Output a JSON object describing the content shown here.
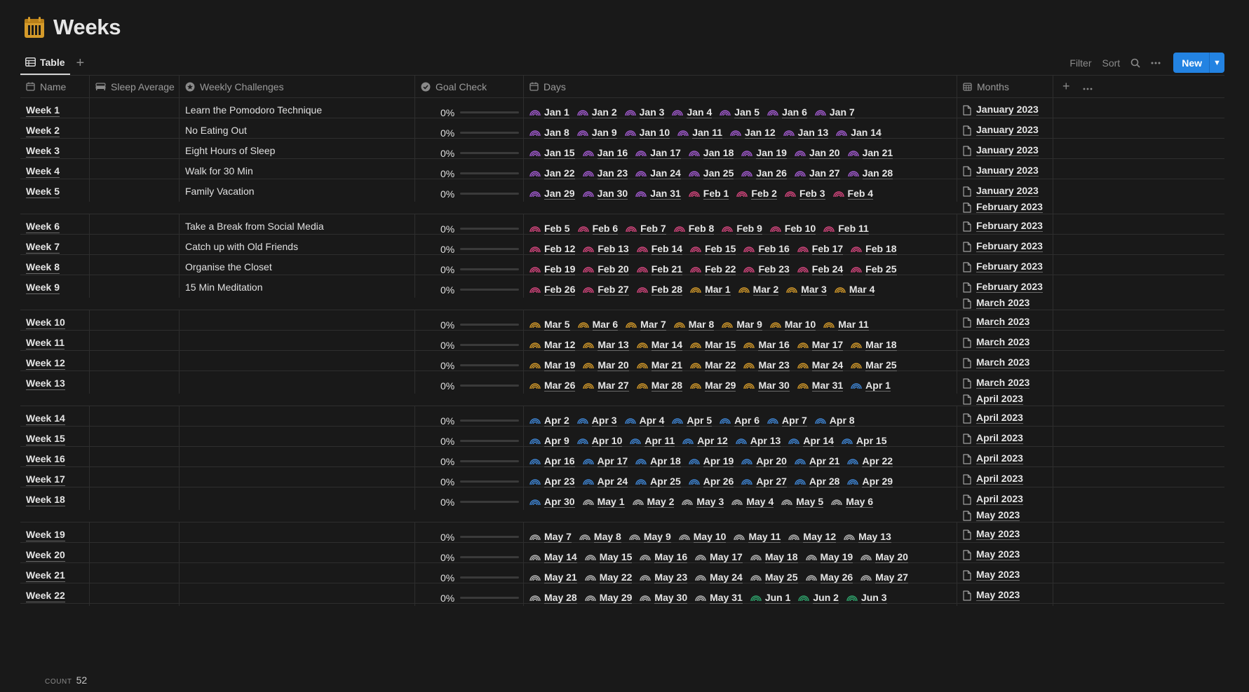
{
  "page": {
    "title": "Weeks"
  },
  "view": {
    "tab_label": "Table",
    "filter_label": "Filter",
    "sort_label": "Sort",
    "new_label": "New"
  },
  "columns": {
    "name": "Name",
    "sleep": "Sleep Average",
    "challenges": "Weekly Challenges",
    "goal": "Goal Check",
    "days": "Days",
    "months": "Months"
  },
  "colors": {
    "jan": "#a35bd1",
    "feb": "#d6467e",
    "mar": "#d49a2a",
    "apr": "#3f86d6",
    "may": "#b8b8b8",
    "jun": "#2fa56d",
    "accent": "#2383e2"
  },
  "rows": [
    {
      "name": "Week 1",
      "challenge": "Learn the Pomodoro Technique",
      "goal": "0%",
      "progress": 0,
      "days": [
        [
          "Jan 1",
          "jan"
        ],
        [
          "Jan 2",
          "jan"
        ],
        [
          "Jan 3",
          "jan"
        ],
        [
          "Jan 4",
          "jan"
        ],
        [
          "Jan 5",
          "jan"
        ],
        [
          "Jan 6",
          "jan"
        ],
        [
          "Jan 7",
          "jan"
        ]
      ],
      "months": [
        "January 2023"
      ]
    },
    {
      "name": "Week 2",
      "challenge": "No Eating Out",
      "goal": "0%",
      "progress": 0,
      "days": [
        [
          "Jan 8",
          "jan"
        ],
        [
          "Jan 9",
          "jan"
        ],
        [
          "Jan 10",
          "jan"
        ],
        [
          "Jan 11",
          "jan"
        ],
        [
          "Jan 12",
          "jan"
        ],
        [
          "Jan 13",
          "jan"
        ],
        [
          "Jan 14",
          "jan"
        ]
      ],
      "months": [
        "January 2023"
      ]
    },
    {
      "name": "Week 3",
      "challenge": "Eight Hours of Sleep",
      "goal": "0%",
      "progress": 0,
      "days": [
        [
          "Jan 15",
          "jan"
        ],
        [
          "Jan 16",
          "jan"
        ],
        [
          "Jan 17",
          "jan"
        ],
        [
          "Jan 18",
          "jan"
        ],
        [
          "Jan 19",
          "jan"
        ],
        [
          "Jan 20",
          "jan"
        ],
        [
          "Jan 21",
          "jan"
        ]
      ],
      "months": [
        "January 2023"
      ]
    },
    {
      "name": "Week 4",
      "challenge": "Walk for 30 Min",
      "goal": "0%",
      "progress": 0,
      "days": [
        [
          "Jan 22",
          "jan"
        ],
        [
          "Jan 23",
          "jan"
        ],
        [
          "Jan 24",
          "jan"
        ],
        [
          "Jan 25",
          "jan"
        ],
        [
          "Jan 26",
          "jan"
        ],
        [
          "Jan 27",
          "jan"
        ],
        [
          "Jan 28",
          "jan"
        ]
      ],
      "months": [
        "January 2023"
      ]
    },
    {
      "name": "Week 5",
      "challenge": "Family Vacation",
      "goal": "0%",
      "progress": 0,
      "days": [
        [
          "Jan 29",
          "jan"
        ],
        [
          "Jan 30",
          "jan"
        ],
        [
          "Jan 31",
          "jan"
        ],
        [
          "Feb 1",
          "feb"
        ],
        [
          "Feb 2",
          "feb"
        ],
        [
          "Feb 3",
          "feb"
        ],
        [
          "Feb 4",
          "feb"
        ]
      ],
      "months": [
        "January 2023",
        "February 2023"
      ]
    },
    {
      "name": "Week 6",
      "challenge": "Take a Break from Social Media",
      "goal": "0%",
      "progress": 0,
      "days": [
        [
          "Feb 5",
          "feb"
        ],
        [
          "Feb 6",
          "feb"
        ],
        [
          "Feb 7",
          "feb"
        ],
        [
          "Feb 8",
          "feb"
        ],
        [
          "Feb 9",
          "feb"
        ],
        [
          "Feb 10",
          "feb"
        ],
        [
          "Feb 11",
          "feb"
        ]
      ],
      "months": [
        "February 2023"
      ]
    },
    {
      "name": "Week 7",
      "challenge": "Catch up with Old Friends",
      "goal": "0%",
      "progress": 0,
      "days": [
        [
          "Feb 12",
          "feb"
        ],
        [
          "Feb 13",
          "feb"
        ],
        [
          "Feb 14",
          "feb"
        ],
        [
          "Feb 15",
          "feb"
        ],
        [
          "Feb 16",
          "feb"
        ],
        [
          "Feb 17",
          "feb"
        ],
        [
          "Feb 18",
          "feb"
        ]
      ],
      "months": [
        "February 2023"
      ]
    },
    {
      "name": "Week 8",
      "challenge": "Organise the Closet",
      "goal": "0%",
      "progress": 0,
      "days": [
        [
          "Feb 19",
          "feb"
        ],
        [
          "Feb 20",
          "feb"
        ],
        [
          "Feb 21",
          "feb"
        ],
        [
          "Feb 22",
          "feb"
        ],
        [
          "Feb 23",
          "feb"
        ],
        [
          "Feb 24",
          "feb"
        ],
        [
          "Feb 25",
          "feb"
        ]
      ],
      "months": [
        "February 2023"
      ]
    },
    {
      "name": "Week 9",
      "challenge": "15 Min Meditation",
      "goal": "0%",
      "progress": 0,
      "days": [
        [
          "Feb 26",
          "feb"
        ],
        [
          "Feb 27",
          "feb"
        ],
        [
          "Feb 28",
          "feb"
        ],
        [
          "Mar 1",
          "mar"
        ],
        [
          "Mar 2",
          "mar"
        ],
        [
          "Mar 3",
          "mar"
        ],
        [
          "Mar 4",
          "mar"
        ]
      ],
      "months": [
        "February 2023",
        "March 2023"
      ]
    },
    {
      "name": "Week 10",
      "challenge": "",
      "goal": "0%",
      "progress": 0,
      "days": [
        [
          "Mar 5",
          "mar"
        ],
        [
          "Mar 6",
          "mar"
        ],
        [
          "Mar 7",
          "mar"
        ],
        [
          "Mar 8",
          "mar"
        ],
        [
          "Mar 9",
          "mar"
        ],
        [
          "Mar 10",
          "mar"
        ],
        [
          "Mar 11",
          "mar"
        ]
      ],
      "months": [
        "March 2023"
      ]
    },
    {
      "name": "Week 11",
      "challenge": "",
      "goal": "0%",
      "progress": 0,
      "days": [
        [
          "Mar 12",
          "mar"
        ],
        [
          "Mar 13",
          "mar"
        ],
        [
          "Mar 14",
          "mar"
        ],
        [
          "Mar 15",
          "mar"
        ],
        [
          "Mar 16",
          "mar"
        ],
        [
          "Mar 17",
          "mar"
        ],
        [
          "Mar 18",
          "mar"
        ]
      ],
      "months": [
        "March 2023"
      ]
    },
    {
      "name": "Week 12",
      "challenge": "",
      "goal": "0%",
      "progress": 0,
      "days": [
        [
          "Mar 19",
          "mar"
        ],
        [
          "Mar 20",
          "mar"
        ],
        [
          "Mar 21",
          "mar"
        ],
        [
          "Mar 22",
          "mar"
        ],
        [
          "Mar 23",
          "mar"
        ],
        [
          "Mar 24",
          "mar"
        ],
        [
          "Mar 25",
          "mar"
        ]
      ],
      "months": [
        "March 2023"
      ]
    },
    {
      "name": "Week 13",
      "challenge": "",
      "goal": "0%",
      "progress": 0,
      "days": [
        [
          "Mar 26",
          "mar"
        ],
        [
          "Mar 27",
          "mar"
        ],
        [
          "Mar 28",
          "mar"
        ],
        [
          "Mar 29",
          "mar"
        ],
        [
          "Mar 30",
          "mar"
        ],
        [
          "Mar 31",
          "mar"
        ],
        [
          "Apr 1",
          "apr"
        ]
      ],
      "months": [
        "March 2023",
        "April 2023"
      ]
    },
    {
      "name": "Week 14",
      "challenge": "",
      "goal": "0%",
      "progress": 0,
      "days": [
        [
          "Apr 2",
          "apr"
        ],
        [
          "Apr 3",
          "apr"
        ],
        [
          "Apr 4",
          "apr"
        ],
        [
          "Apr 5",
          "apr"
        ],
        [
          "Apr 6",
          "apr"
        ],
        [
          "Apr 7",
          "apr"
        ],
        [
          "Apr 8",
          "apr"
        ]
      ],
      "months": [
        "April 2023"
      ]
    },
    {
      "name": "Week 15",
      "challenge": "",
      "goal": "0%",
      "progress": 0,
      "days": [
        [
          "Apr 9",
          "apr"
        ],
        [
          "Apr 10",
          "apr"
        ],
        [
          "Apr 11",
          "apr"
        ],
        [
          "Apr 12",
          "apr"
        ],
        [
          "Apr 13",
          "apr"
        ],
        [
          "Apr 14",
          "apr"
        ],
        [
          "Apr 15",
          "apr"
        ]
      ],
      "months": [
        "April 2023"
      ]
    },
    {
      "name": "Week 16",
      "challenge": "",
      "goal": "0%",
      "progress": 0,
      "days": [
        [
          "Apr 16",
          "apr"
        ],
        [
          "Apr 17",
          "apr"
        ],
        [
          "Apr 18",
          "apr"
        ],
        [
          "Apr 19",
          "apr"
        ],
        [
          "Apr 20",
          "apr"
        ],
        [
          "Apr 21",
          "apr"
        ],
        [
          "Apr 22",
          "apr"
        ]
      ],
      "months": [
        "April 2023"
      ]
    },
    {
      "name": "Week 17",
      "challenge": "",
      "goal": "0%",
      "progress": 0,
      "days": [
        [
          "Apr 23",
          "apr"
        ],
        [
          "Apr 24",
          "apr"
        ],
        [
          "Apr 25",
          "apr"
        ],
        [
          "Apr 26",
          "apr"
        ],
        [
          "Apr 27",
          "apr"
        ],
        [
          "Apr 28",
          "apr"
        ],
        [
          "Apr 29",
          "apr"
        ]
      ],
      "months": [
        "April 2023"
      ]
    },
    {
      "name": "Week 18",
      "challenge": "",
      "goal": "0%",
      "progress": 0,
      "days": [
        [
          "Apr 30",
          "apr"
        ],
        [
          "May 1",
          "may"
        ],
        [
          "May 2",
          "may"
        ],
        [
          "May 3",
          "may"
        ],
        [
          "May 4",
          "may"
        ],
        [
          "May 5",
          "may"
        ],
        [
          "May 6",
          "may"
        ]
      ],
      "months": [
        "April 2023",
        "May 2023"
      ]
    },
    {
      "name": "Week 19",
      "challenge": "",
      "goal": "0%",
      "progress": 0,
      "days": [
        [
          "May 7",
          "may"
        ],
        [
          "May 8",
          "may"
        ],
        [
          "May 9",
          "may"
        ],
        [
          "May 10",
          "may"
        ],
        [
          "May 11",
          "may"
        ],
        [
          "May 12",
          "may"
        ],
        [
          "May 13",
          "may"
        ]
      ],
      "months": [
        "May 2023"
      ]
    },
    {
      "name": "Week 20",
      "challenge": "",
      "goal": "0%",
      "progress": 0,
      "days": [
        [
          "May 14",
          "may"
        ],
        [
          "May 15",
          "may"
        ],
        [
          "May 16",
          "may"
        ],
        [
          "May 17",
          "may"
        ],
        [
          "May 18",
          "may"
        ],
        [
          "May 19",
          "may"
        ],
        [
          "May 20",
          "may"
        ]
      ],
      "months": [
        "May 2023"
      ]
    },
    {
      "name": "Week 21",
      "challenge": "",
      "goal": "0%",
      "progress": 0,
      "days": [
        [
          "May 21",
          "may"
        ],
        [
          "May 22",
          "may"
        ],
        [
          "May 23",
          "may"
        ],
        [
          "May 24",
          "may"
        ],
        [
          "May 25",
          "may"
        ],
        [
          "May 26",
          "may"
        ],
        [
          "May 27",
          "may"
        ]
      ],
      "months": [
        "May 2023"
      ]
    },
    {
      "name": "Week 22",
      "challenge": "",
      "goal": "0%",
      "progress": 0,
      "days": [
        [
          "May 28",
          "may"
        ],
        [
          "May 29",
          "may"
        ],
        [
          "May 30",
          "may"
        ],
        [
          "May 31",
          "may"
        ],
        [
          "Jun 1",
          "jun"
        ],
        [
          "Jun 2",
          "jun"
        ],
        [
          "Jun 3",
          "jun"
        ]
      ],
      "months": [
        "May 2023"
      ]
    }
  ],
  "footer": {
    "count_label": "COUNT",
    "count_value": "52"
  }
}
